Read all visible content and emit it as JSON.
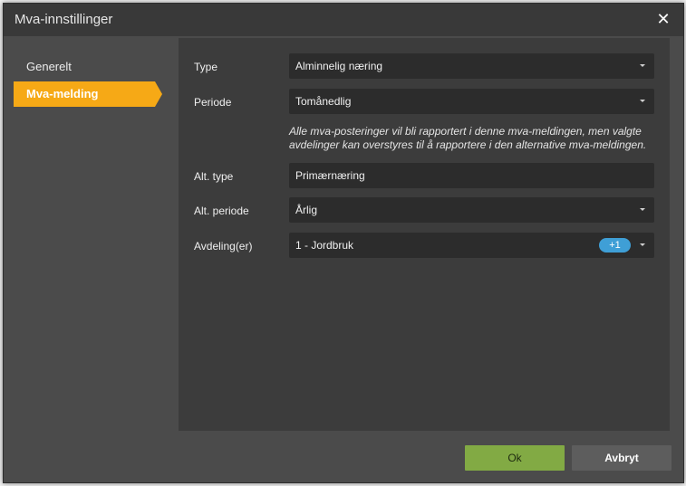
{
  "dialog": {
    "title": "Mva-innstillinger",
    "close_glyph": "✕"
  },
  "nav": {
    "items": [
      {
        "label": "Generelt",
        "active": false
      },
      {
        "label": "Mva-melding",
        "active": true
      }
    ]
  },
  "form": {
    "type": {
      "label": "Type",
      "value": "Alminnelig næring"
    },
    "periode": {
      "label": "Periode",
      "value": "Tomånedlig"
    },
    "note": "Alle mva-posteringer vil bli rapportert i denne mva-meldingen, men valgte avdelinger kan overstyres til å rapportere i den alternative mva-meldingen.",
    "alt_type": {
      "label": "Alt. type",
      "value": "Primærnæring"
    },
    "alt_periode": {
      "label": "Alt. periode",
      "value": "Årlig"
    },
    "avdeling": {
      "label": "Avdeling(er)",
      "value": "1 - Jordbruk",
      "extra_count": "+1"
    }
  },
  "buttons": {
    "ok": "Ok",
    "cancel": "Avbryt"
  },
  "colors": {
    "accent": "#f6a916",
    "ok": "#82aa44",
    "badge": "#3f9fd6"
  }
}
